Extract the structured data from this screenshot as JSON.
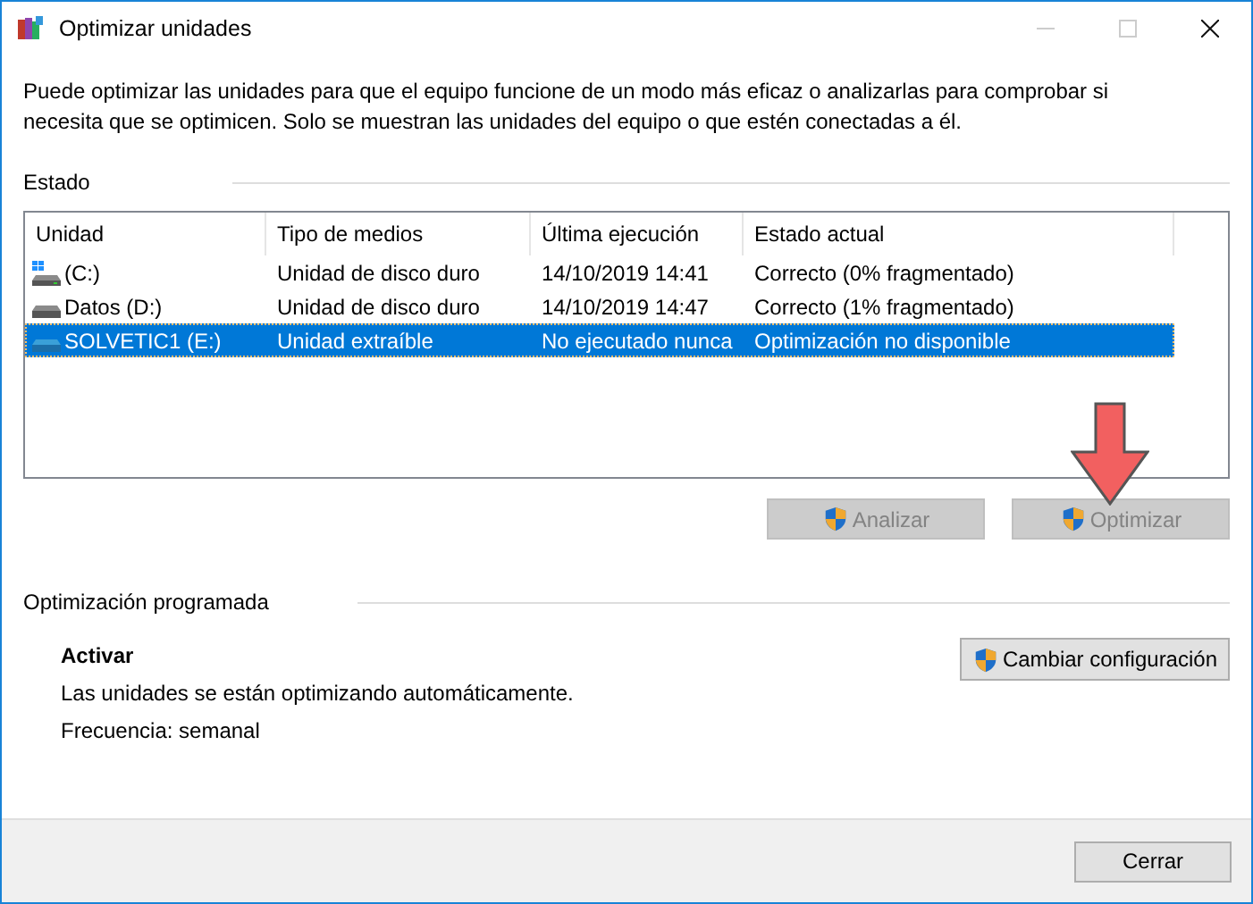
{
  "window": {
    "title": "Optimizar unidades"
  },
  "description": "Puede optimizar las unidades para que el equipo funcione de un modo más eficaz o analizarlas para comprobar si necesita que se optimicen. Solo se muestran las unidades del equipo o que estén conectadas a él.",
  "status_section": {
    "title": "Estado"
  },
  "table": {
    "columns": [
      "Unidad",
      "Tipo de medios",
      "Última ejecución",
      "Estado actual"
    ],
    "rows": [
      {
        "kind": "system",
        "selected": false,
        "cells": [
          "(C:)",
          "Unidad de disco duro",
          "14/10/2019 14:41",
          "Correcto (0% fragmentado)"
        ]
      },
      {
        "kind": "hdd",
        "selected": false,
        "cells": [
          "Datos (D:)",
          "Unidad de disco duro",
          "14/10/2019 14:47",
          "Correcto (1% fragmentado)"
        ]
      },
      {
        "kind": "removable",
        "selected": true,
        "cells": [
          "SOLVETIC1 (E:)",
          "Unidad extraíble",
          "No ejecutado nunca",
          "Optimización no disponible"
        ]
      }
    ]
  },
  "actions": [
    {
      "label": "Analizar",
      "disabled": true
    },
    {
      "label": "Optimizar",
      "disabled": true
    }
  ],
  "scheduled": {
    "title": "Optimización programada",
    "heading": "Activar",
    "status": "Las unidades se están optimizando automáticamente.",
    "frequency": "Frecuencia: semanal",
    "button": {
      "label": "Cambiar configuración",
      "disabled": false
    }
  },
  "footer": {
    "button": {
      "label": "Cerrar",
      "disabled": false
    }
  }
}
